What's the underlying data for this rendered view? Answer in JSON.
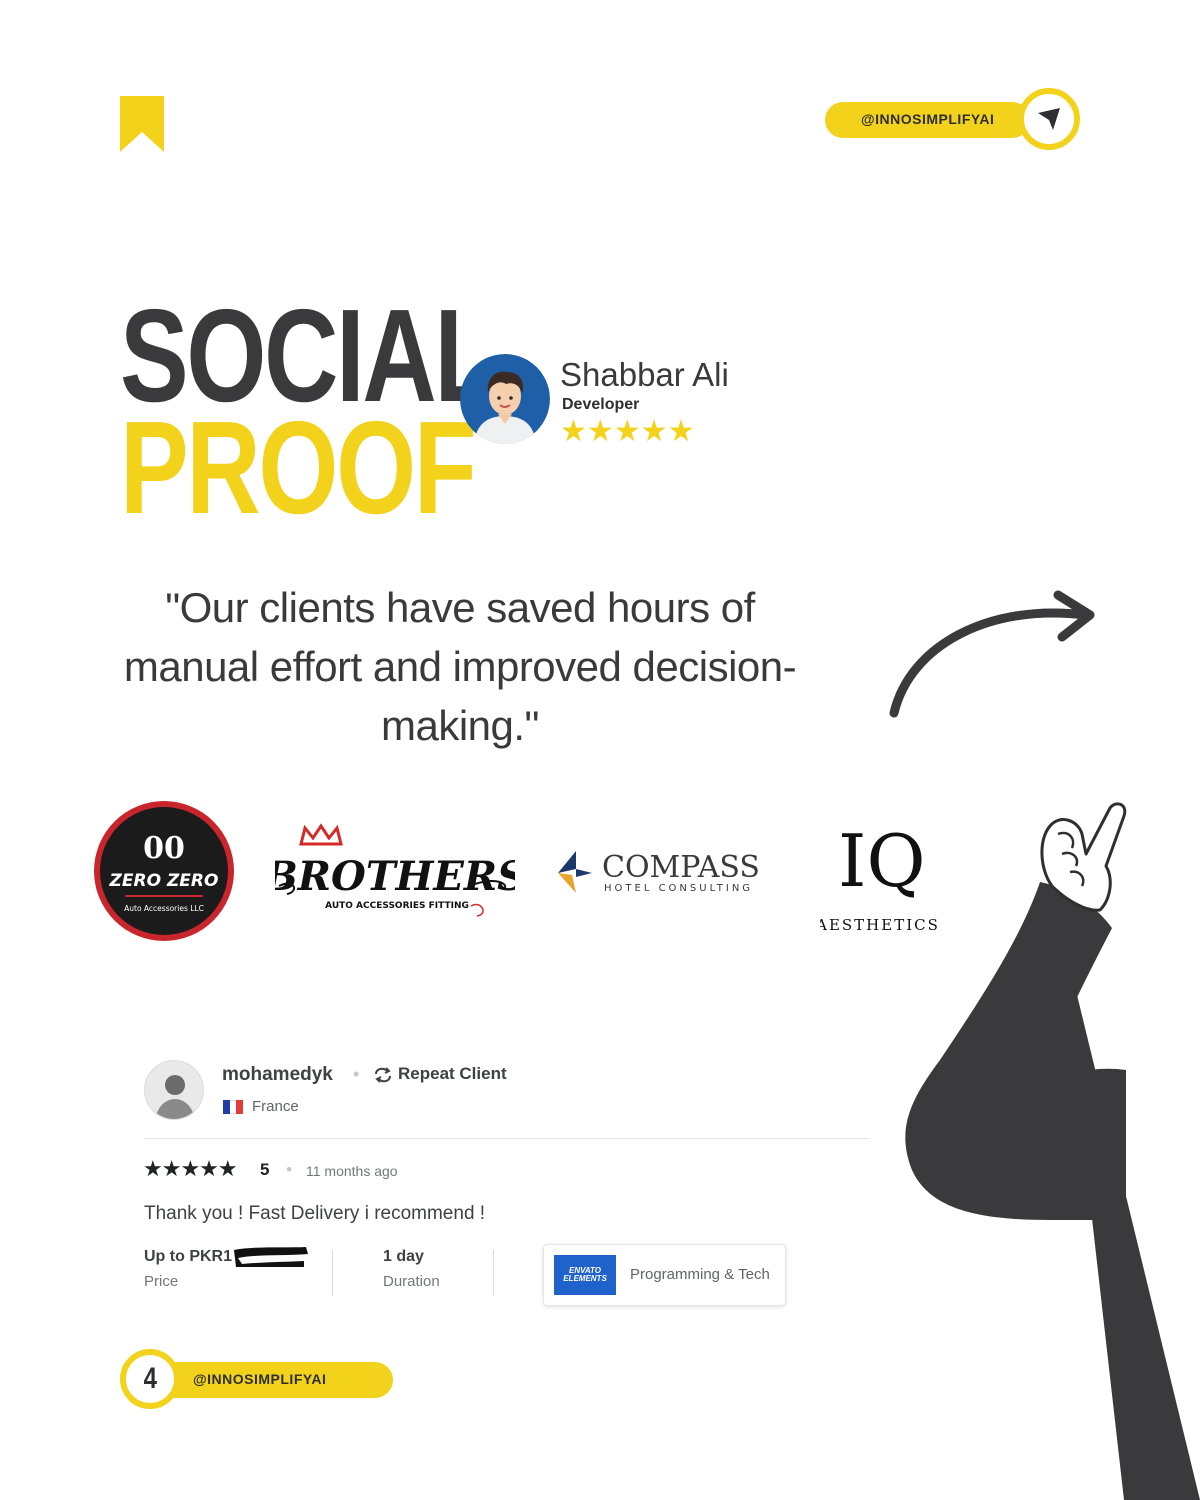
{
  "brand": {
    "handle": "@INNOSIMPLIFYAI",
    "accent_color": "#f2d21b",
    "dark_color": "#3a3a3d",
    "page_number": "4"
  },
  "header": {
    "title_line1": "SOCIAL",
    "title_line2": "PROOF"
  },
  "reviewer": {
    "name": "Shabbar Ali",
    "role": "Developer",
    "stars": "★★★★★",
    "rating": 5
  },
  "quote": "\"Our clients have saved hours of manual effort and improved decision-making.\"",
  "client_logos": [
    {
      "name": "ZERO ZERO",
      "top_text": "00",
      "sub": "Auto Accessories LLC"
    },
    {
      "name": "BROTHERS",
      "sub": "AUTO ACCESSORIES FITTING"
    },
    {
      "name": "COMPASS",
      "sub": "HOTEL CONSULTING"
    },
    {
      "name": "IQ",
      "sub": "AESTHETICS"
    }
  ],
  "review_card": {
    "username": "mohamedyk",
    "repeat_label": "Repeat Client",
    "country": "France",
    "stars": "★★★★★",
    "rating": "5",
    "time_ago": "11 months ago",
    "comment": "Thank you ! Fast Delivery i recommend !",
    "price_value": "Up to PKR1",
    "price_label": "Price",
    "duration_value": "1 day",
    "duration_label": "Duration",
    "category": "Programming & Tech",
    "thumb_text": "ENVATO ELEMENTS"
  },
  "icons": {
    "bookmark": "bookmark-icon",
    "send": "send-icon",
    "arrow": "curved-arrow-icon",
    "pointing_hand": "pointing-hand-illustration",
    "repeat": "repeat-icon",
    "flag": "france-flag-icon"
  }
}
